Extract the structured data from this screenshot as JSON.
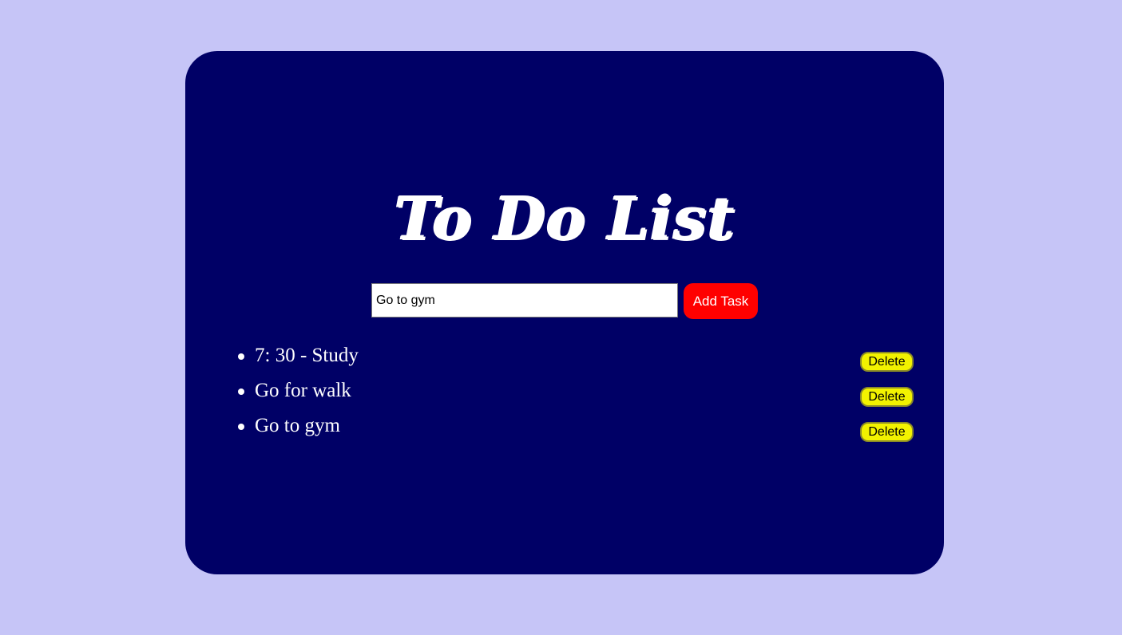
{
  "page": {
    "background_color": "#c6c5f7"
  },
  "card": {
    "background_color": "#000066",
    "title": "To Do List"
  },
  "form": {
    "input_value": "Go to gym",
    "add_label": "Add Task",
    "add_color": "#ff0000"
  },
  "tasks": [
    {
      "text": "7: 30 - Study",
      "delete_label": "Delete"
    },
    {
      "text": "Go for walk",
      "delete_label": "Delete"
    },
    {
      "text": "Go to gym",
      "delete_label": "Delete"
    }
  ],
  "colors": {
    "delete_button": "#f2f200",
    "text": "#ffffff"
  }
}
